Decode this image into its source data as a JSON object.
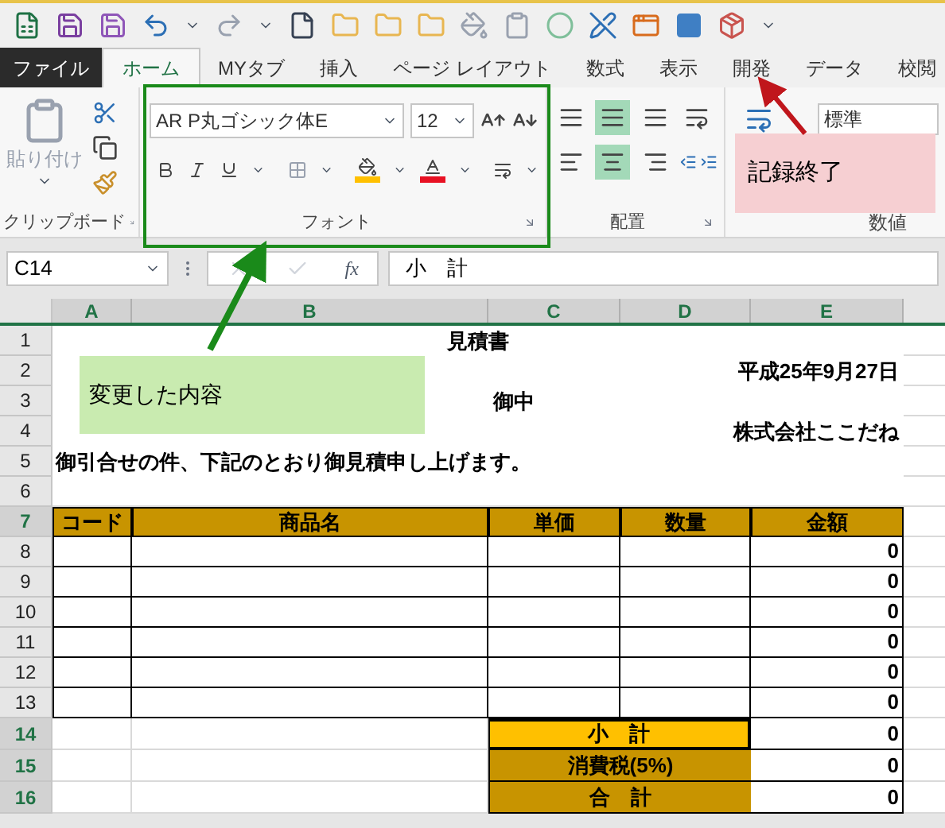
{
  "tabs": [
    {
      "label": "ファイル",
      "kind": "file",
      "selected": false
    },
    {
      "label": "ホーム",
      "kind": "tab",
      "selected": true
    },
    {
      "label": "MYタブ",
      "kind": "tab",
      "selected": false
    },
    {
      "label": "挿入",
      "kind": "tab",
      "selected": false
    },
    {
      "label": "ページ レイアウト",
      "kind": "tab",
      "selected": false
    },
    {
      "label": "数式",
      "kind": "tab",
      "selected": false
    },
    {
      "label": "表示",
      "kind": "tab",
      "selected": false
    },
    {
      "label": "開発",
      "kind": "tab",
      "selected": false
    },
    {
      "label": "データ",
      "kind": "tab",
      "selected": false
    },
    {
      "label": "校閲",
      "kind": "tab",
      "selected": false
    }
  ],
  "ribbon": {
    "clipboard": {
      "paste_label": "貼り付け",
      "group_label": "クリップボード"
    },
    "font": {
      "font_name": "AR P丸ゴシック体E",
      "font_size": "12",
      "group_label": "フォント"
    },
    "alignment": {
      "group_label": "配置",
      "buttons": [
        {
          "selected": false
        },
        {
          "selected": true
        },
        {
          "selected": false
        },
        {
          "selected": false
        },
        {
          "selected": true
        },
        {
          "selected": false
        }
      ]
    },
    "number": {
      "format": "標準",
      "group_label": "数値"
    }
  },
  "formula_bar": {
    "name_box": "C14",
    "function_label": "fx",
    "content": "小　計"
  },
  "sheet": {
    "columns": [
      "A",
      "B",
      "C",
      "D",
      "E"
    ],
    "rows": [
      {
        "number": "1",
        "kind": "title",
        "text": "見積書",
        "highlighted": false
      },
      {
        "number": "2",
        "kind": "date",
        "text": "平成25年9月27日",
        "highlighted": false
      },
      {
        "number": "3",
        "kind": "addressee",
        "text": "御中",
        "highlighted": false
      },
      {
        "number": "4",
        "kind": "company",
        "text": "株式会社ここだね",
        "highlighted": false
      },
      {
        "number": "5",
        "kind": "message",
        "text": "御引合せの件、下記のとおり御見積申し上げます。",
        "highlighted": false
      },
      {
        "number": "6",
        "kind": "blank",
        "highlighted": false
      },
      {
        "number": "7",
        "kind": "header",
        "cells": [
          "コード",
          "商品名",
          "単価",
          "数量",
          "金額"
        ],
        "highlighted": true
      },
      {
        "number": "8",
        "kind": "item",
        "amount": "0",
        "highlighted": false
      },
      {
        "number": "9",
        "kind": "item",
        "amount": "0",
        "highlighted": false
      },
      {
        "number": "10",
        "kind": "item",
        "amount": "0",
        "highlighted": false
      },
      {
        "number": "11",
        "kind": "item",
        "amount": "0",
        "highlighted": false
      },
      {
        "number": "12",
        "kind": "item",
        "amount": "0",
        "highlighted": false
      },
      {
        "number": "13",
        "kind": "item",
        "amount": "0",
        "highlighted": false
      },
      {
        "number": "14",
        "kind": "total",
        "label": "小　計",
        "amount": "0",
        "selected": true,
        "highlighted": true
      },
      {
        "number": "15",
        "kind": "total",
        "label": "消費税(5%)",
        "amount": "0",
        "selected": false,
        "highlighted": true
      },
      {
        "number": "16",
        "kind": "total",
        "label": "合　計",
        "amount": "0",
        "selected": false,
        "highlighted": true
      }
    ]
  },
  "annotations": [
    {
      "kind": "changed",
      "text": "変更した内容"
    },
    {
      "kind": "stop",
      "text": "記録終了"
    }
  ]
}
